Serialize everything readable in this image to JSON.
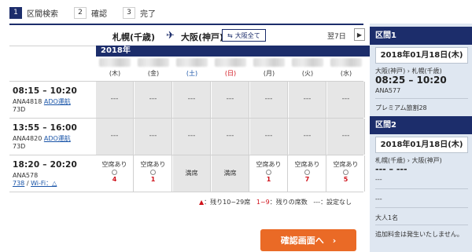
{
  "steps": [
    {
      "num": "1",
      "label": "区間検索"
    },
    {
      "num": "2",
      "label": "確認"
    },
    {
      "num": "3",
      "label": "完了"
    }
  ],
  "route": {
    "from": "札幌(千歳)",
    "to": "大阪(神戸)",
    "all_button": "大阪全て",
    "next_label": "翌7日",
    "next_icon": "▶"
  },
  "year": "2018年",
  "days": [
    "(木)",
    "(金)",
    "(土)",
    "(日)",
    "(月)",
    "(火)",
    "(水)"
  ],
  "day_colors": [
    "#333333",
    "#333333",
    "#1a55a8",
    "#d0121b",
    "#333333",
    "#333333",
    "#333333"
  ],
  "flights": [
    {
      "time": "08:15 – 10:20",
      "number": "ANA4818",
      "operator": "ADO運航",
      "aircraft": "73D",
      "extra": "",
      "cells": [
        {
          "type": "none",
          "text": "---"
        },
        {
          "type": "none",
          "text": "---"
        },
        {
          "type": "none",
          "text": "---"
        },
        {
          "type": "none",
          "text": "---"
        },
        {
          "type": "none",
          "text": "---"
        },
        {
          "type": "none",
          "text": "---"
        },
        {
          "type": "none",
          "text": "---"
        }
      ]
    },
    {
      "time": "13:55 – 16:00",
      "number": "ANA4820",
      "operator": "ADO運航",
      "aircraft": "73D",
      "extra": "",
      "cells": [
        {
          "type": "none",
          "text": "---"
        },
        {
          "type": "none",
          "text": "---"
        },
        {
          "type": "none",
          "text": "---"
        },
        {
          "type": "none",
          "text": "---"
        },
        {
          "type": "none",
          "text": "---"
        },
        {
          "type": "none",
          "text": "---"
        },
        {
          "type": "none",
          "text": "---"
        }
      ]
    },
    {
      "time": "18:20 – 20:20",
      "number": "ANA578",
      "operator": "",
      "aircraft": "738",
      "extra": "Wi-Fi：△",
      "cells": [
        {
          "type": "avail",
          "text": "空席あり",
          "count": "4"
        },
        {
          "type": "avail",
          "text": "空席あり",
          "count": "1"
        },
        {
          "type": "full",
          "text": "満席"
        },
        {
          "type": "full",
          "text": "満席"
        },
        {
          "type": "avail",
          "text": "空席あり",
          "count": "1"
        },
        {
          "type": "avail",
          "text": "空席あり",
          "count": "7"
        },
        {
          "type": "avail",
          "text": "空席あり",
          "count": "5"
        }
      ]
    }
  ],
  "legend": {
    "tri": "▲",
    "tri_text": "：残り10~29席",
    "range": "1~9",
    "range_text": "：残りの席数",
    "dash": "---",
    "dash_text": "：設定なし"
  },
  "confirm_button": "確認画面へ　›",
  "panel": {
    "seg1": {
      "title": "区間1",
      "date": "2018年01月18日(木)",
      "route": "大阪(神戸) › 札幌(千歳)",
      "time": "08:25 – 10:20",
      "flight": "ANA577",
      "fare": "プレミアム旅割28"
    },
    "seg2": {
      "title": "区間2",
      "date": "2018年01月18日(木)",
      "route": "札幌(千歳) › 大阪(神戸)",
      "time": "--- – ---",
      "flight": "---",
      "fare": "---"
    },
    "pax": "大人1名",
    "note": "追加料金は発生いたしません。"
  },
  "colors": {
    "navy": "#1c2d6b",
    "orange": "#ea6a26",
    "red": "#d0121b",
    "panel_bg": "#dfe7f1"
  }
}
